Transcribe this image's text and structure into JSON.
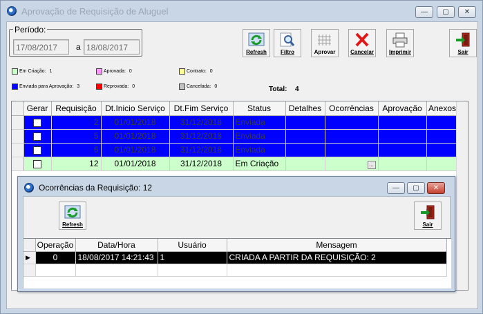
{
  "window": {
    "title": "Aprovação de Requisição de Aluguel",
    "controls": {
      "minimize": "—",
      "maximize": "▢",
      "close": "✕"
    }
  },
  "period": {
    "label": "Período:",
    "from": "17/08/2017",
    "separator": "a",
    "to": "18/08/2017"
  },
  "toolbar": {
    "refresh": "Refresh",
    "filtro": "Filtro",
    "aprovar": "Aprovar",
    "cancelar": "Cancelar",
    "imprimir": "Imprimir",
    "sair": "Sair"
  },
  "legend": {
    "items": [
      {
        "label": "Em Criação:",
        "count": "1",
        "color": "#ccffcc"
      },
      {
        "label": "Aprovada:",
        "count": "0",
        "color": "#ff99ff"
      },
      {
        "label": "Contrato:",
        "count": "0",
        "color": "#ffff99"
      },
      {
        "label": "Enviada para Aprovação:",
        "count": "3",
        "color": "#0000ff"
      },
      {
        "label": "Reprovada:",
        "count": "0",
        "color": "#ff0000"
      },
      {
        "label": "Cancelada:",
        "count": "0",
        "color": "#c0c0c0"
      }
    ],
    "total_label": "Total:",
    "total_value": "4"
  },
  "grid": {
    "columns": [
      "Gerar",
      "Requisição",
      "Dt.Inicio Serviço",
      "Dt.Fim Serviço",
      "Status",
      "Detalhes",
      "Ocorrências",
      "Aprovação",
      "Anexos"
    ],
    "rows": [
      {
        "requisicao": "2",
        "inicio": "01/01/2018",
        "fim": "31/12/2018",
        "status": "Enviada"
      },
      {
        "requisicao": "5",
        "inicio": "01/01/2018",
        "fim": "31/12/2018",
        "status": "Enviada"
      },
      {
        "requisicao": "6",
        "inicio": "01/01/2018",
        "fim": "31/12/2018",
        "status": "Enviada"
      },
      {
        "requisicao": "12",
        "inicio": "01/01/2018",
        "fim": "31/12/2018",
        "status": "Em Criação",
        "ocorrencias_btn": "..."
      }
    ]
  },
  "dialog": {
    "title": "Ocorrências da Requisição: 12",
    "refresh": "Refresh",
    "sair": "Sair",
    "columns": [
      "Operação",
      "Data/Hora",
      "Usuário",
      "Mensagem"
    ],
    "rows": [
      {
        "operacao": "0",
        "datahora": "18/08/2017 14:21:43",
        "usuario": "1",
        "mensagem": "CRIADA A PARTIR DA REQUISIÇÃO: 2",
        "indicator": "▶"
      }
    ]
  },
  "colors": {
    "enviada": "#0000ff",
    "em_criacao": "#ccffcc",
    "selected_row": "#000000",
    "titlebar": "#c9d6e6"
  }
}
